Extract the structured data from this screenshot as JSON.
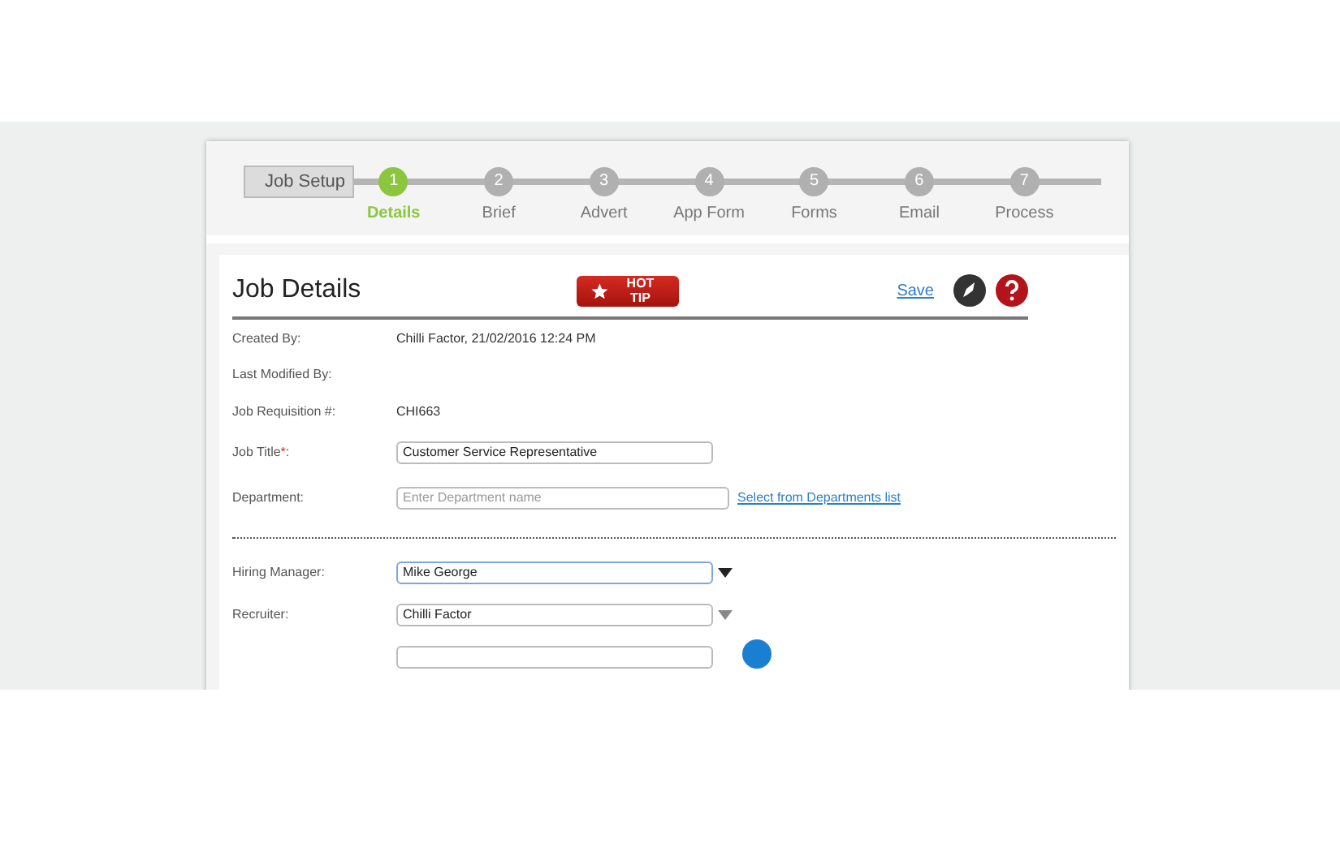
{
  "stepper": {
    "start_label": "Job Setup",
    "steps": [
      {
        "number": "1",
        "label": "Details",
        "selected": true
      },
      {
        "number": "2",
        "label": "Brief",
        "selected": false
      },
      {
        "number": "3",
        "label": "Advert",
        "selected": false
      },
      {
        "number": "4",
        "label": "App Form",
        "selected": false
      },
      {
        "number": "5",
        "label": "Forms",
        "selected": false
      },
      {
        "number": "6",
        "label": "Email",
        "selected": false
      },
      {
        "number": "7",
        "label": "Process",
        "selected": false
      }
    ]
  },
  "card": {
    "title": "Job Details",
    "hot_tip": "HOT TIP",
    "save": "Save",
    "rows": [
      {
        "kind": "text",
        "label": "Created By:",
        "value": "Chilli Factor, 21/02/2016   12:24 PM"
      },
      {
        "kind": "text",
        "label": "Last Modified By:"
      },
      {
        "kind": "text",
        "label": "Job Requisition #:",
        "value": "CHI663"
      },
      {
        "kind": "input",
        "label": "Job Title",
        "required_mark": "*",
        "label_end": ":",
        "value": "Customer Service Representative"
      },
      {
        "kind": "input",
        "label": "Department:",
        "placeholder": "Enter Department name",
        "link": "Select from Departments list"
      },
      {
        "kind": "divider"
      },
      {
        "kind": "select",
        "label": "Hiring Manager:",
        "value": "Mike George",
        "focused": true
      },
      {
        "kind": "select",
        "label": "Recruiter:",
        "value": "Chilli Factor",
        "focused": false
      },
      {
        "kind": "cut"
      }
    ]
  }
}
